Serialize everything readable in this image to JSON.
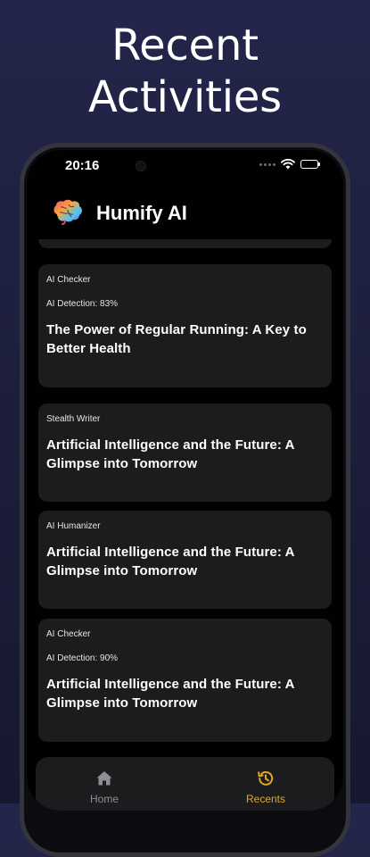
{
  "hero": {
    "line1": "Recent",
    "line2": "Activities"
  },
  "status_bar": {
    "time": "20:16"
  },
  "app": {
    "title": "Humify AI"
  },
  "activities": [
    {
      "tool": "AI Checker",
      "detection": "AI Detection: 83%",
      "title": "The Power of Regular Running: A Key to Better Health"
    },
    {
      "tool": "Stealth Writer",
      "detection": null,
      "title": "Artificial Intelligence and the Future: A Glimpse into Tomorrow"
    },
    {
      "tool": "AI Humanizer",
      "detection": null,
      "title": "Artificial Intelligence and the Future: A Glimpse into Tomorrow"
    },
    {
      "tool": "AI Checker",
      "detection": "AI Detection: 90%",
      "title": "Artificial Intelligence and the Future: A Glimpse into Tomorrow"
    }
  ],
  "tab_bar": {
    "home_label": "Home",
    "recents_label": "Recents",
    "home_icon": "home-icon",
    "recents_icon": "history-icon",
    "active_color": "#e0a820",
    "inactive_color": "#8e8e93"
  }
}
